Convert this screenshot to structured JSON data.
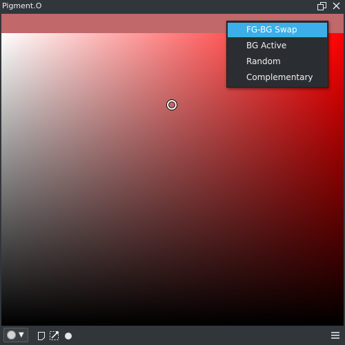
{
  "window": {
    "title": "Pigment.O"
  },
  "colors": {
    "current_color": "#c0686a",
    "hue": "#ff0000",
    "menu_highlight": "#3daee9",
    "panel_bg": "#31363b"
  },
  "picker": {
    "mode": "saturation-value square",
    "hue_degrees": 0
  },
  "context_menu": {
    "items": [
      {
        "label": "FG-BG Swap",
        "highlighted": true
      },
      {
        "label": "BG Active",
        "highlighted": false
      },
      {
        "label": "Random",
        "highlighted": false
      },
      {
        "label": "Complementary",
        "highlighted": false
      }
    ]
  },
  "bottom_toolbar": {
    "shape_selector_icon": "circle-icon",
    "buttons": [
      "note-icon",
      "eyedropper-selection-icon",
      "dot-icon",
      "hamburger-menu-icon"
    ]
  }
}
